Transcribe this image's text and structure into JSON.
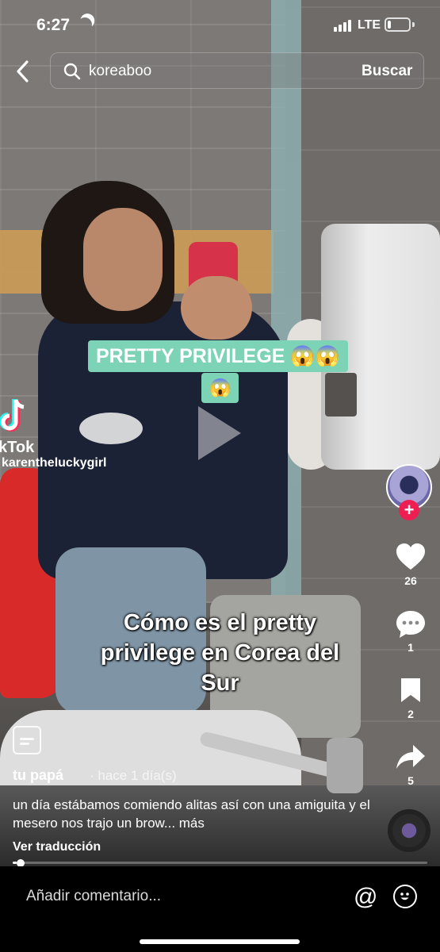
{
  "status_bar": {
    "time": "6:27",
    "network": "LTE",
    "battery_percent": 15
  },
  "search": {
    "query": "koreaboo",
    "submit_label": "Buscar"
  },
  "video": {
    "sticker_line1": "PRETTY PRIVILEGE 😱😱",
    "sticker_line2": "😱",
    "caption": "Cómo es el pretty privilege en Corea del Sur",
    "watermark_logo": "kTok",
    "watermark_handle": "karentheluckygirl",
    "progress": 0.01
  },
  "actions": {
    "likes": "26",
    "comments": "1",
    "saves": "2",
    "shares": "5"
  },
  "post": {
    "author": "tu papá",
    "time_ago": "· hace 1 día(s)",
    "description": "un día estábamos comiendo alitas así con una amiguita y el mesero nos trajo un brow... más",
    "translate_label": "Ver traducción"
  },
  "comment_bar": {
    "placeholder": "Añadir comentario...",
    "mention_symbol": "@"
  },
  "colors": {
    "sticker_bg": "#7dd3b5",
    "follow_red": "#ee1d52"
  }
}
